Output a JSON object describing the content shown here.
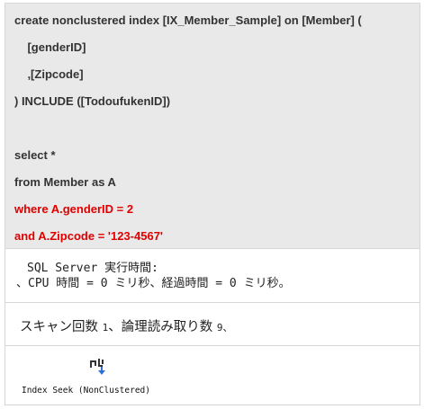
{
  "code": {
    "lines": [
      "create nonclustered index [IX_Member_Sample] on [Member] (",
      "    [genderID]",
      "    ,[Zipcode]",
      ") INCLUDE ([TodoufukenID])",
      "",
      "select *",
      "from Member as A",
      "where A.genderID = 2",
      "and A.Zipcode = '123-4567'"
    ],
    "highlight_color": "#e00000"
  },
  "messages": {
    "time_header": "SQL Server 実行時間:",
    "time_detail": "、CPU 時間 = 0 ミリ秒、経過時間 = 0 ミリ秒。",
    "scan_label": "スキャン回数 ",
    "scan_count": "1",
    "logical_label": "、論理読み取り数 ",
    "logical_count": "9",
    "logical_suffix": "、"
  },
  "plan": {
    "icon": "index-seek-icon",
    "operator_label": "Index Seek (NonClustered)"
  }
}
